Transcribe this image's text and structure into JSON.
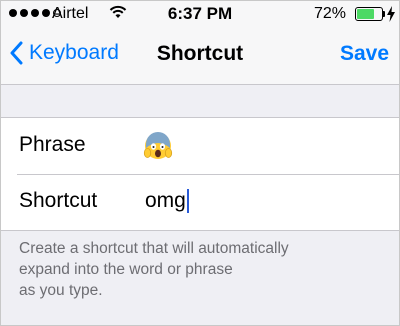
{
  "status_bar": {
    "carrier": "Airtel",
    "time": "6:37 PM",
    "battery_percent": "72%",
    "battery_level": 0.72,
    "signal_bars_filled": 4,
    "signal_bars_total": 5
  },
  "nav": {
    "back_label": "Keyboard",
    "title": "Shortcut",
    "save_label": "Save",
    "accent_color": "#007aff"
  },
  "form": {
    "phrase_label": "Phrase",
    "phrase_value_icon": "face-screaming-in-fear-emoji",
    "shortcut_label": "Shortcut",
    "shortcut_value": "omg"
  },
  "help_text": "Create a shortcut that will automatically\n expand into the word or phrase\n as you type."
}
